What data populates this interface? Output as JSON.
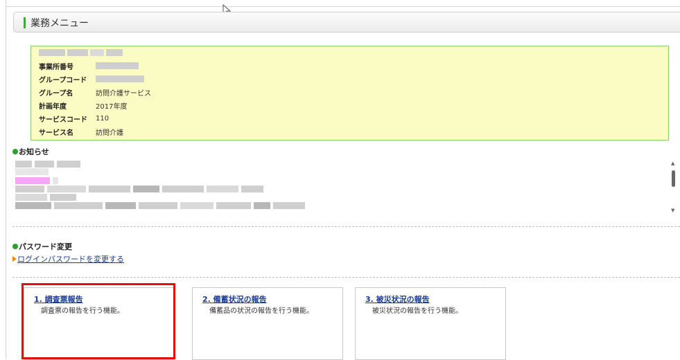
{
  "header": {
    "title": "業務メニュー"
  },
  "info": {
    "rows": [
      {
        "label": "事業所番号",
        "value": ""
      },
      {
        "label": "グループコード",
        "value": ""
      },
      {
        "label": "グループ名",
        "value": "訪問介護サービス"
      },
      {
        "label": "計画年度",
        "value": "2017年度"
      },
      {
        "label": "サービスコード",
        "value": "110"
      },
      {
        "label": "サービス名",
        "value": "訪問介護"
      }
    ]
  },
  "notice": {
    "title": "お知らせ"
  },
  "password": {
    "title": "パスワード変更",
    "link": "ログインパスワードを変更する"
  },
  "cards": [
    {
      "title": "1. 調査票報告",
      "desc": "調査票の報告を行う機能。"
    },
    {
      "title": "2. 備蓄状況の報告",
      "desc": "備蓄品の状況の報告を行う機能。"
    },
    {
      "title": "3. 被災状況の報告",
      "desc": "被災状況の報告を行う機能。"
    }
  ],
  "colors": {
    "accent_green": "#3cab3c",
    "info_bg": "#fbfbc4",
    "link_blue": "#1a3a9a",
    "highlight_red": "#e01010",
    "marker_orange": "#f08a00"
  }
}
